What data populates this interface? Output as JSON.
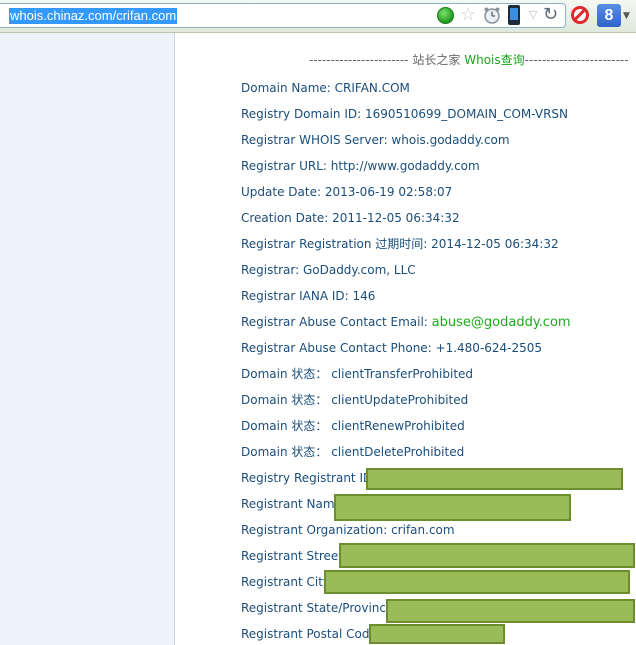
{
  "browser": {
    "url": "whois.chinaz.com/crifan.com",
    "icons": [
      "go-icon",
      "star-icon",
      "clock-icon",
      "phone-icon",
      "dropdown-triangle-icon",
      "reload-icon",
      "adblock-icon",
      "google-search-icon"
    ],
    "search_engine_letter": "8"
  },
  "heading": {
    "prefix": "----------------------- 站长之家 ",
    "highlight": "Whois查询",
    "suffix": "------------------------"
  },
  "whois": {
    "domain_name": "Domain Name: CRIFAN.COM",
    "registry_domain_id": "Registry Domain ID: 1690510699_DOMAIN_COM-VRSN",
    "whois_server": "Registrar WHOIS Server: whois.godaddy.com",
    "registrar_url": "Registrar URL: http://www.godaddy.com",
    "update_date": "Update Date: 2013-06-19 02:58:07",
    "creation_date": "Creation Date: 2011-12-05 06:34:32",
    "expiration": "Registrar Registration 过期时间: 2014-12-05 06:34:32",
    "registrar": "Registrar: GoDaddy.com, LLC",
    "iana_id": "Registrar IANA ID: 146",
    "abuse_email_label": "Registrar Abuse Contact Email: ",
    "abuse_email": "abuse@godaddy.com",
    "abuse_phone": "Registrar Abuse Contact Phone: +1.480-624-2505",
    "status": [
      "Domain 状态： clientTransferProhibited",
      "Domain 状态： clientUpdateProhibited",
      "Domain 状态： clientRenewProhibited",
      "Domain 状态： clientDeleteProhibited"
    ],
    "registrant_id": "Registry Registrant ID:",
    "registrant_name": "Registrant Name:",
    "registrant_org": "Registrant Organization: crifan.com",
    "registrant_street": "Registrant Street:",
    "registrant_city": "Registrant City:",
    "registrant_state": "Registrant State/Province:",
    "registrant_postal": "Registrant Postal Code:"
  },
  "colors": {
    "redaction": "#9bbb59",
    "text": "#1b4e7a",
    "link": "#1eaa1e",
    "url_selection": "#3399ff"
  }
}
